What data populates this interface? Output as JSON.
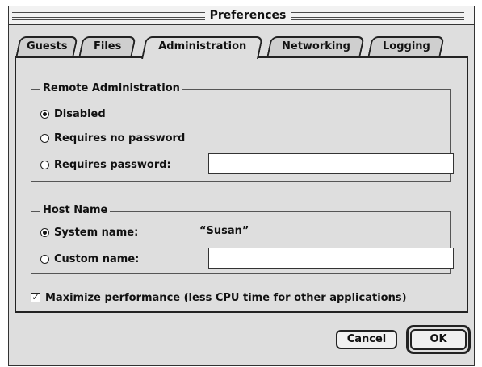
{
  "window": {
    "title": "Preferences"
  },
  "tabs": [
    {
      "label": "Guests",
      "active": false
    },
    {
      "label": "Files",
      "active": false
    },
    {
      "label": "Administration",
      "active": true
    },
    {
      "label": "Networking",
      "active": false
    },
    {
      "label": "Logging",
      "active": false
    }
  ],
  "remote_admin": {
    "legend": "Remote Administration",
    "options": [
      {
        "label": "Disabled",
        "selected": true
      },
      {
        "label": "Requires no password",
        "selected": false
      },
      {
        "label": "Requires password:",
        "selected": false
      }
    ],
    "password_value": ""
  },
  "host_name": {
    "legend": "Host Name",
    "system_label": "System name:",
    "system_value": "“Susan”",
    "custom_label": "Custom name:",
    "custom_value": "",
    "selected": "system"
  },
  "maximize": {
    "label": "Maximize performance (less CPU time for other applications)",
    "checked": true,
    "check_glyph": "✓"
  },
  "buttons": {
    "cancel": "Cancel",
    "ok": "OK"
  }
}
